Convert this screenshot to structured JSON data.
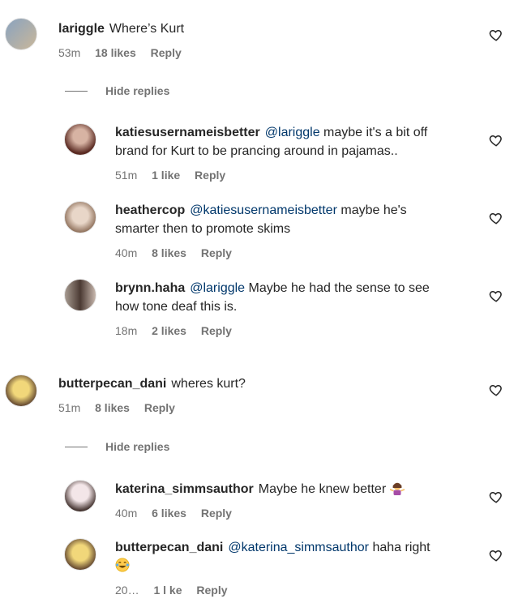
{
  "comments": [
    {
      "username": "lariggle",
      "mention": "",
      "text": "Where’s Kurt",
      "time": "53m",
      "likes": "18 likes",
      "reply": "Reply",
      "avatar_colors": [
        "#8aa3bf",
        "#c9b79a"
      ]
    },
    {
      "username": "butterpecan_dani",
      "mention": "",
      "text": "wheres kurt?",
      "time": "51m",
      "likes": "8 likes",
      "reply": "Reply",
      "avatar_colors": [
        "#f1d77a",
        "#5b3f2b"
      ]
    }
  ],
  "hide_replies_label": "Hide replies",
  "replies_group1": [
    {
      "username": "katiesusernameisbetter",
      "mention": "@lariggle",
      "text_line1": "maybe it's a bit off",
      "text_line2": "brand for Kurt to be prancing around in pajamas..",
      "time": "51m",
      "likes": "1 like",
      "reply": "Reply",
      "avatar_colors": [
        "#d7b3a3",
        "#5a2a22"
      ]
    },
    {
      "username": "heathercop",
      "mention": "@katiesusernameisbetter",
      "text_line1": "maybe he's",
      "text_line2": "smarter then to promote skims",
      "time": "40m",
      "likes": "8 likes",
      "reply": "Reply",
      "avatar_colors": [
        "#e8d6c8",
        "#8a6b55"
      ]
    },
    {
      "username": "brynn.haha",
      "mention": "@lariggle",
      "text_line1": "Maybe he had the sense to see",
      "text_line2": "how tone deaf this is.",
      "time": "18m",
      "likes": "2 likes",
      "reply": "Reply",
      "avatar_colors": [
        "#a89c92",
        "#4b3a33"
      ]
    }
  ],
  "replies_group2": [
    {
      "username": "katerina_simmsauthor",
      "mention": "",
      "text_line1": "Maybe he knew better",
      "text_line2": "",
      "emoji": "woman-shrugging-emoji",
      "time": "40m",
      "likes": "6 likes",
      "reply": "Reply",
      "avatar_colors": [
        "#f3e6e8",
        "#3b2a26"
      ]
    },
    {
      "username": "butterpecan_dani",
      "mention": "@katerina_simmsauthor",
      "text_line1": "haha right",
      "text_line2": "",
      "emoji": "laughing-tears-emoji",
      "time": "20…",
      "likes": "1 l ke",
      "reply": "Reply",
      "avatar_colors": [
        "#f1d77a",
        "#5b3f2b"
      ]
    }
  ]
}
